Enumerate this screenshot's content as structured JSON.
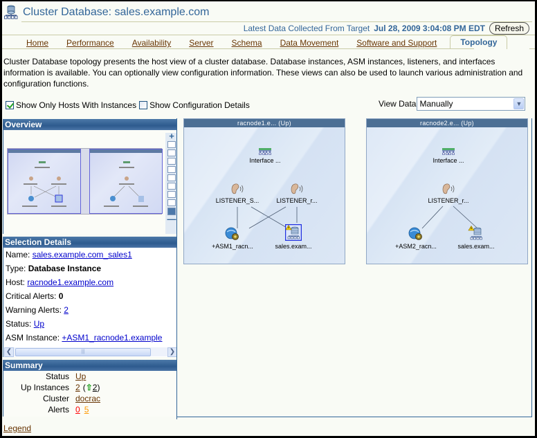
{
  "header": {
    "title": "Cluster Database: sales.example.com",
    "collected_label": "Latest Data Collected From Target",
    "collected_timestamp": "Jul 28, 2009 3:04:08 PM EDT",
    "refresh_label": "Refresh"
  },
  "tabs": [
    {
      "label": "Home",
      "active": false
    },
    {
      "label": "Performance",
      "active": false
    },
    {
      "label": "Availability",
      "active": false
    },
    {
      "label": "Server",
      "active": false
    },
    {
      "label": "Schema",
      "active": false
    },
    {
      "label": "Data Movement",
      "active": false
    },
    {
      "label": "Software and Support",
      "active": false
    },
    {
      "label": "Topology",
      "active": true
    }
  ],
  "description": "Cluster Database topology presents the host view of a cluster database. Database instances, ASM instances, listeners, and interfaces information is available. You can optionally view configuration information. These views can also be used to launch various administration and configuration functions.",
  "options": {
    "show_only_hosts": {
      "label": "Show Only Hosts With Instances",
      "checked": true
    },
    "show_config": {
      "label": "Show Configuration Details",
      "checked": false
    },
    "view_data_label": "View Data",
    "view_data_value": "Manually"
  },
  "overview": {
    "title": "Overview",
    "zoom_levels": 9,
    "zoom_selected": 9
  },
  "selection_details": {
    "title": "Selection Details",
    "name_label": "Name:",
    "name_value": "sales.example.com_sales1",
    "type_label": "Type:",
    "type_value": "Database Instance",
    "host_label": "Host:",
    "host_value": "racnode1.example.com",
    "critical_label": "Critical Alerts:",
    "critical_value": "0",
    "warning_label": "Warning Alerts:",
    "warning_value": "2",
    "status_label": "Status:",
    "status_value": "Up",
    "asm_label": "ASM Instance:",
    "asm_value": "+ASM1_racnode1.example"
  },
  "summary": {
    "title": "Summary",
    "status_label": "Status",
    "status_value": "Up",
    "up_instances_label": "Up Instances",
    "up_instances_value": "2",
    "up_instances_up_count": "2",
    "cluster_label": "Cluster",
    "cluster_value": "docrac",
    "alerts_label": "Alerts",
    "alerts_critical": "0",
    "alerts_warning": "5"
  },
  "legend_label": "Legend",
  "topology": {
    "hosts": [
      {
        "title": "racnode1.e... (Up)",
        "interface": "Interface ...",
        "listeners": [
          "LISTENER_S...",
          "LISTENER_r..."
        ],
        "asm": "+ASM1_racn...",
        "database": "sales.exam...",
        "database_selected": true,
        "database_warning": true
      },
      {
        "title": "racnode2.e... (Up)",
        "interface": "Interface ...",
        "listeners": [
          "LISTENER_r..."
        ],
        "asm": "+ASM2_racn...",
        "database": "sales.exam...",
        "database_selected": false,
        "database_warning": true
      }
    ]
  },
  "colors": {
    "header_blue": "#336699",
    "tab_link": "#663300",
    "panel_header": "#2d5b8e",
    "link_blue": "#0000cc",
    "critical": "#ff0000",
    "warning": "#ff9900",
    "up_arrow": "#21a121"
  }
}
